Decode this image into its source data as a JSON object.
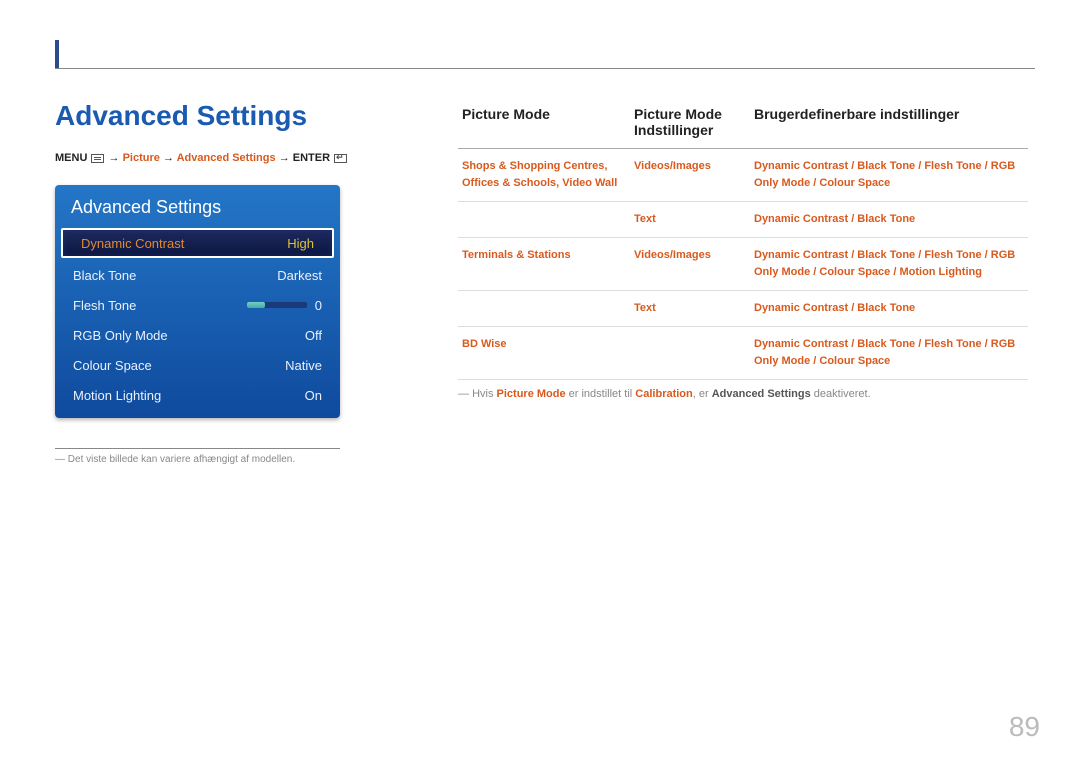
{
  "page": {
    "title": "Advanced Settings",
    "number": "89"
  },
  "breadcrumb": {
    "menu": "MENU",
    "picture": "Picture",
    "advanced": "Advanced Settings",
    "enter": "ENTER",
    "arrow": "→"
  },
  "osd": {
    "title": "Advanced Settings",
    "rows": [
      {
        "label": "Dynamic Contrast",
        "value": "High",
        "selected": true
      },
      {
        "label": "Black Tone",
        "value": "Darkest"
      },
      {
        "label": "Flesh Tone",
        "value": "0",
        "slider": true
      },
      {
        "label": "RGB Only Mode",
        "value": "Off"
      },
      {
        "label": "Colour Space",
        "value": "Native"
      },
      {
        "label": "Motion Lighting",
        "value": "On"
      }
    ]
  },
  "footnote": "Det viste billede kan variere afhængigt af modellen.",
  "table": {
    "headers": {
      "c1": "Picture Mode",
      "c2": "Picture Mode Indstillinger",
      "c3": "Brugerdefinerbare indstillinger"
    },
    "rows": [
      {
        "c1": "Shops & Shopping Centres, Offices & Schools, Video Wall",
        "c2": "Videos/Images",
        "c3": "Dynamic Contrast / Black Tone / Flesh Tone / RGB Only Mode / Colour Space"
      },
      {
        "c1": "",
        "c2": "Text",
        "c3": "Dynamic Contrast / Black Tone"
      },
      {
        "c1": "Terminals & Stations",
        "c2": "Videos/Images",
        "c3": "Dynamic Contrast / Black Tone / Flesh Tone / RGB Only Mode / Colour Space / Motion Lighting"
      },
      {
        "c1": "",
        "c2": "Text",
        "c3": "Dynamic Contrast / Black Tone"
      },
      {
        "c1": "BD Wise",
        "c2": "",
        "c3": "Dynamic Contrast / Black Tone / Flesh Tone / RGB Only Mode / Colour Space"
      }
    ],
    "note": {
      "pre": "Hvis ",
      "pm": "Picture Mode",
      "mid": " er indstillet til ",
      "cal": "Calibration",
      "mid2": ", er ",
      "adv": "Advanced Settings",
      "post": " deaktiveret."
    }
  }
}
